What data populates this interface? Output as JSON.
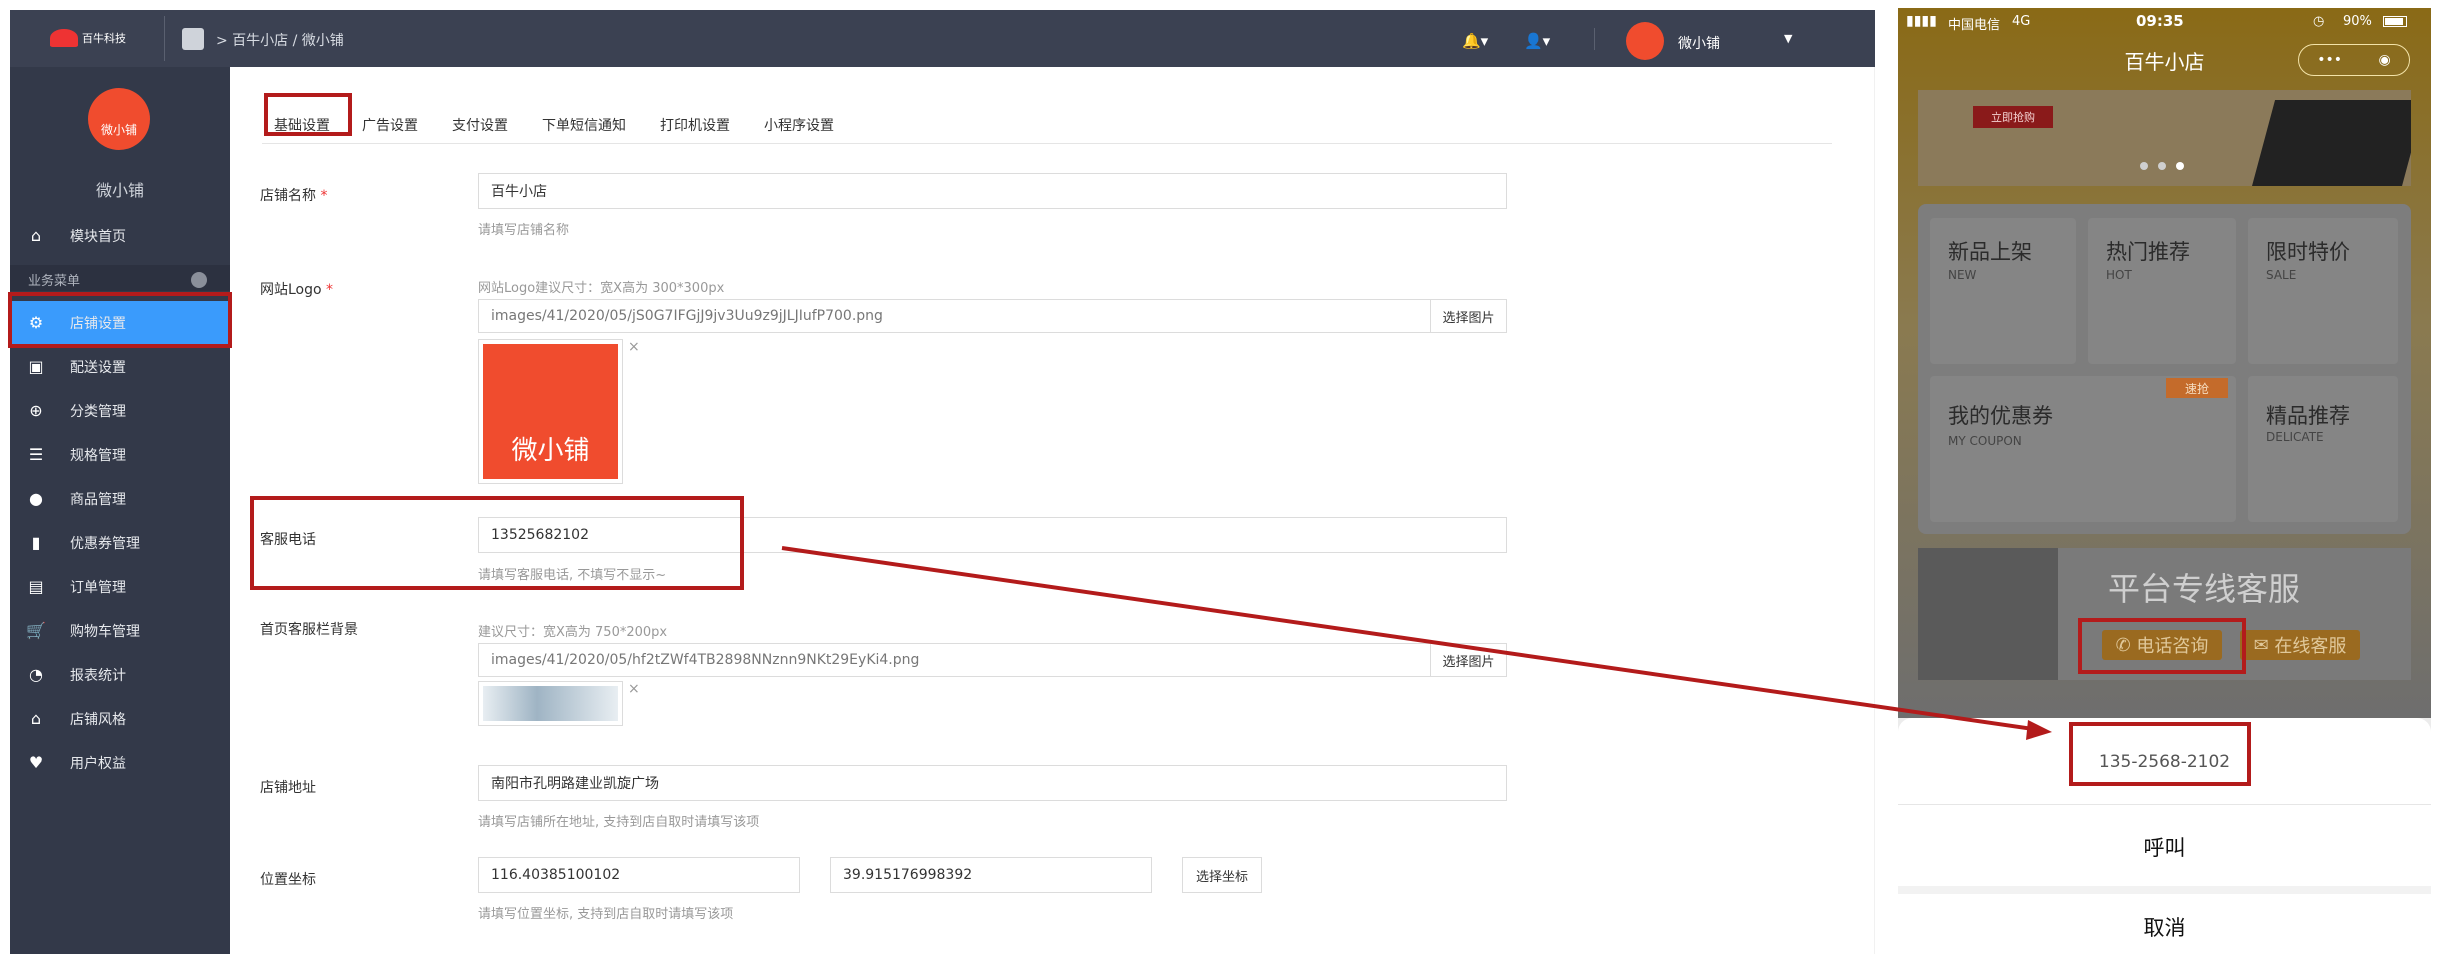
{
  "topbar": {
    "logo_text": "百牛科技",
    "breadcrumb": "> 百牛小店 / 微小铺",
    "bell_icon": "bell-icon",
    "user_icon": "user-icon",
    "username": "微小铺"
  },
  "sidebar": {
    "shop_name": "微小铺",
    "logo_text": "微小铺",
    "group_label": "业务菜单",
    "items": [
      {
        "label": "模块首页",
        "icon": "home-icon"
      },
      {
        "label": "店铺设置",
        "icon": "gear-icon"
      },
      {
        "label": "配送设置",
        "icon": "delivery-icon"
      },
      {
        "label": "分类管理",
        "icon": "category-icon"
      },
      {
        "label": "规格管理",
        "icon": "list-icon"
      },
      {
        "label": "商品管理",
        "icon": "goods-icon"
      },
      {
        "label": "优惠券管理",
        "icon": "coupon-icon"
      },
      {
        "label": "订单管理",
        "icon": "order-icon"
      },
      {
        "label": "购物车管理",
        "icon": "cart-icon"
      },
      {
        "label": "报表统计",
        "icon": "chart-icon"
      },
      {
        "label": "店铺风格",
        "icon": "style-icon"
      },
      {
        "label": "用户权益",
        "icon": "heart-icon"
      }
    ]
  },
  "tabs": [
    "基础设置",
    "广告设置",
    "支付设置",
    "下单短信通知",
    "打印机设置",
    "小程序设置"
  ],
  "form": {
    "shop_name_label": "店铺名称",
    "required_mark": "*",
    "shop_name_value": "百牛小店",
    "shop_name_help": "请填写店铺名称",
    "logo_label": "网站Logo",
    "logo_help": "网站Logo建议尺寸：宽X高为 300*300px",
    "logo_path": "images/41/2020/05/jS0G7IFGjJ9jv3Uu9z9jJLJIufP700.png",
    "choose_image": "选择图片",
    "logo_preview_text": "微小铺",
    "phone_label": "客服电话",
    "phone_value": "13525682102",
    "phone_help": "请填写客服电话, 不填写不显示~",
    "bg_label": "首页客服栏背景",
    "bg_help": "建议尺寸：宽X高为 750*200px",
    "bg_path": "images/41/2020/05/hf2tZWf4TB2898NNznn9NKt29EyKi4.png",
    "address_label": "店铺地址",
    "address_value": "南阳市孔明路建业凯旋广场",
    "address_help": "请填写店铺所在地址, 支持到店自取时请填写该项",
    "coords_label": "位置坐标",
    "longitude": "116.40385100102",
    "latitude": "39.915176998392",
    "choose_coords": "选择坐标",
    "coords_help": "请填写位置坐标, 支持到店自取时请填写该项",
    "remove_mark": "×"
  },
  "phone": {
    "carrier": "中国电信",
    "network": "4G",
    "time": "09:35",
    "battery": "90%",
    "title": "百牛小店",
    "capsule_more": "•••",
    "capsule_close": "◉",
    "banner_button": "立即抢购",
    "tiles": [
      {
        "cn": "新品上架",
        "en": "NEW"
      },
      {
        "cn": "热门推荐",
        "en": "HOT"
      },
      {
        "cn": "限时特价",
        "en": "SALE"
      },
      {
        "cn": "我的优惠券",
        "en": "MY COUPON"
      },
      {
        "cn": "精品推荐",
        "en": "DELICATE"
      }
    ],
    "fast_badge": "速抢",
    "service_title": "平台专线客服",
    "call_button": "电话咨询",
    "online_button": "在线客服",
    "sheet_number": "135-2568-2102",
    "sheet_call": "呼叫",
    "sheet_cancel": "取消"
  },
  "colors": {
    "topbar": "#3b4152",
    "sidebar": "#333949",
    "sidebar_active": "#3a9bfc",
    "annotation_red": "#b31b1b",
    "brand_orange": "#f04c2e"
  }
}
